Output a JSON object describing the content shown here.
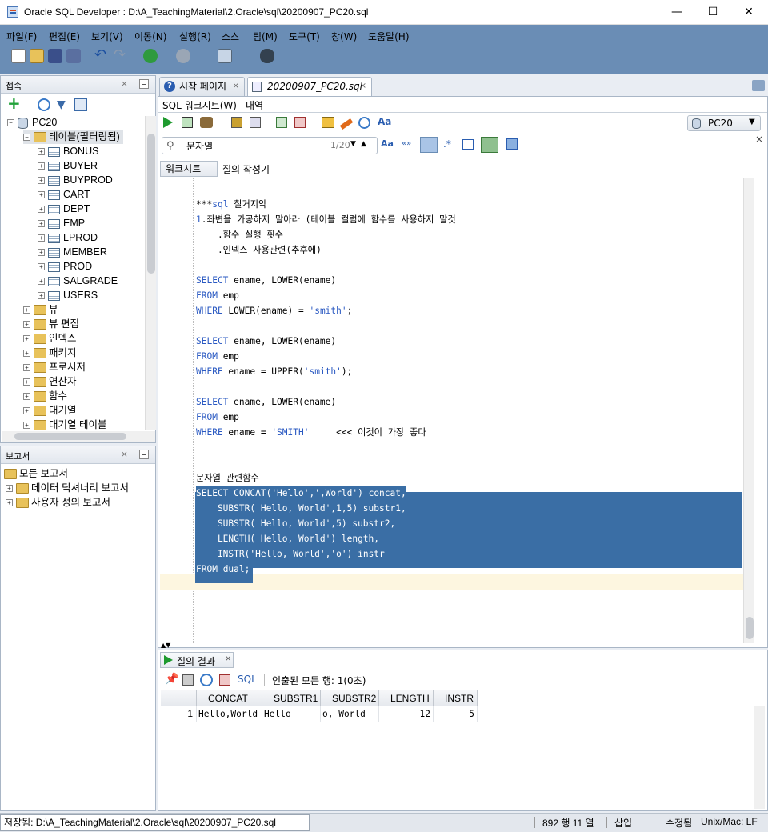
{
  "window": {
    "title": "Oracle SQL Developer : D:\\A_TeachingMaterial\\2.Oracle\\sql\\20200907_PC20.sql"
  },
  "menu": [
    "파일(F)",
    "편집(E)",
    "보기(V)",
    "이동(N)",
    "실행(R)",
    "소스",
    "팀(M)",
    "도구(T)",
    "창(W)",
    "도움말(H)"
  ],
  "connections": {
    "panel_title": "접속",
    "root": "PC20",
    "tables_node": "테이블(필터링됨)",
    "tables": [
      "BONUS",
      "BUYER",
      "BUYPROD",
      "CART",
      "DEPT",
      "EMP",
      "LPROD",
      "MEMBER",
      "PROD",
      "SALGRADE",
      "USERS"
    ],
    "other_nodes": [
      "뷰",
      "뷰 편집",
      "인덱스",
      "패키지",
      "프로시저",
      "연산자",
      "함수",
      "대기열",
      "대기열 테이블"
    ]
  },
  "reports": {
    "panel_title": "보고서",
    "items": [
      "모든 보고서",
      "데이터 딕셔너리 보고서",
      "사용자 정의 보고서"
    ]
  },
  "tabs": [
    {
      "label": "시작 페이지"
    },
    {
      "label": "20200907_PC20.sql"
    }
  ],
  "subtabs": {
    "worksheet": "SQL 워크시트(W)",
    "history": "내역"
  },
  "connection_selector": "PC20",
  "find": {
    "value": "문자열",
    "count": "1/20"
  },
  "editor_tabs": {
    "worksheet": "워크시트",
    "query_builder": "질의 작성기"
  },
  "code_lines": [
    "",
    "***sql 칠거지악",
    "1.좌변을 가공하지 말아라 (테이블 컬럼에 함수를 사용하지 말것",
    "    .함수 실행 횟수",
    "    .인덱스 사용관련(추후에)",
    "",
    "SELECT ename, LOWER(ename)",
    "FROM emp",
    "WHERE LOWER(ename) = 'smith';",
    "",
    "SELECT ename, LOWER(ename)",
    "FROM emp",
    "WHERE ename = UPPER('smith');",
    "",
    "SELECT ename, LOWER(ename)",
    "FROM emp",
    "WHERE ename = 'SMITH'     <<< 이것이 가장 좋다",
    "",
    "",
    "문자열 관련함수",
    "SELECT CONCAT('Hello',',World') concat,",
    "    SUBSTR('Hello, World',1,5) substr1,",
    "    SUBSTR('Hello, World',5) substr2,",
    "    LENGTH('Hello, World') length,",
    "    INSTR('Hello, World','o') instr",
    "FROM dual;"
  ],
  "results": {
    "tab_label": "질의 결과",
    "sql_link": "SQL",
    "status": "인출된 모든 행: 1(0초)",
    "columns": [
      "CONCAT",
      "SUBSTR1",
      "SUBSTR2",
      "LENGTH",
      "INSTR"
    ],
    "rows": [
      {
        "num": "1",
        "cells": [
          "Hello,World",
          "Hello",
          "o, World",
          "12",
          "5"
        ]
      }
    ]
  },
  "statusbar": {
    "path": "저장됨: D:\\A_TeachingMaterial\\2.Oracle\\sql\\20200907_PC20.sql",
    "position": "892 행 11 열",
    "mode": "삽입",
    "modified": "수정됨",
    "line_ending": "Unix/Mac: LF"
  },
  "colors": {
    "toolbar": "#6a8db5",
    "selection": "#3a6ea5",
    "keyword": "#2a59c2"
  }
}
